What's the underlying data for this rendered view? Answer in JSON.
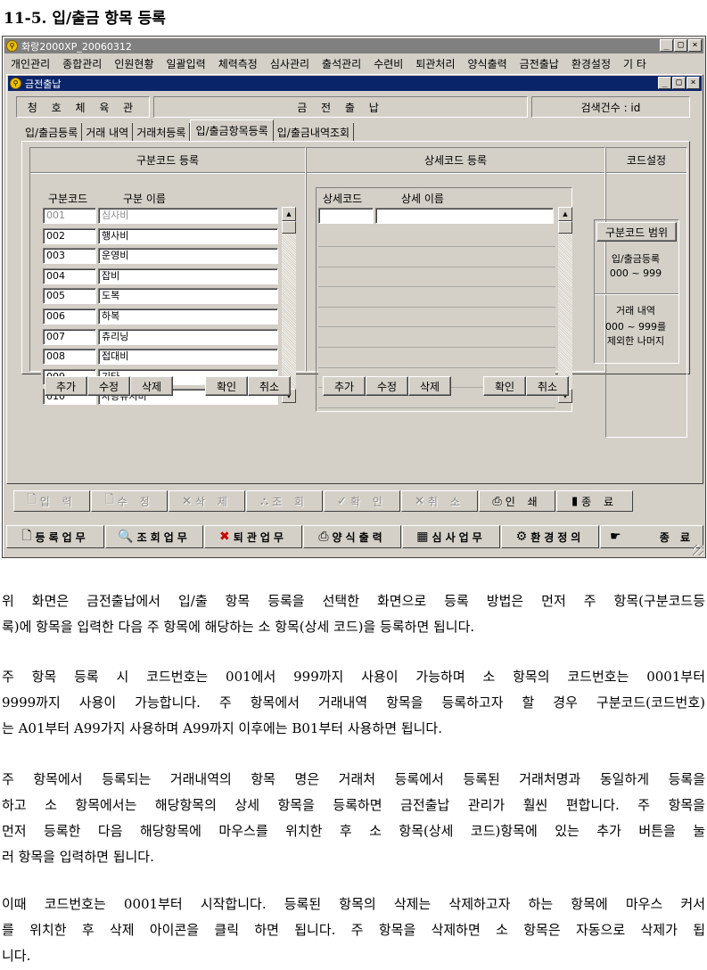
{
  "doc_heading": "11-5. 입/출금 항목 등록",
  "app": {
    "title": "화랑2000XP_20060312",
    "window_buttons": [
      "_",
      "□",
      "×"
    ],
    "menu": [
      "개인관리",
      "종합관리",
      "인원현황",
      "일괄입력",
      "체력측정",
      "심사관리",
      "출석관리",
      "수련비",
      "퇴관처리",
      "양식출력",
      "금전출납",
      "환경설정",
      "기 타"
    ]
  },
  "child": {
    "title": "금전출납",
    "header": {
      "gym_name": "청 호 체 육 관",
      "module": "금 전 출 납",
      "search_count": "검색건수 : id"
    },
    "tabs": [
      "입/출금등록",
      "거래 내역",
      "거래처등록",
      "입/출금항목등록",
      "입/출금내역조회"
    ],
    "active_tab": 3,
    "category": {
      "title": "구분코드 등록",
      "col_code": "구분코드",
      "col_name": "구분 이름",
      "rows": [
        {
          "code": "001",
          "name": "심사비"
        },
        {
          "code": "002",
          "name": "행사비"
        },
        {
          "code": "003",
          "name": "운영비"
        },
        {
          "code": "004",
          "name": "잡비"
        },
        {
          "code": "005",
          "name": "도복"
        },
        {
          "code": "006",
          "name": "하복"
        },
        {
          "code": "007",
          "name": "츄리닝"
        },
        {
          "code": "008",
          "name": "접대비"
        },
        {
          "code": "009",
          "name": "기타"
        },
        {
          "code": "010",
          "name": "차량유지비"
        }
      ],
      "buttons": [
        "추가",
        "수정",
        "삭제"
      ],
      "confirm_buttons": [
        "확인",
        "취소"
      ]
    },
    "detail": {
      "title": "상세코드 등록",
      "col_code": "상세코드",
      "col_name": "상세 이름",
      "buttons": [
        "추가",
        "수정",
        "삭제"
      ],
      "confirm_buttons": [
        "확인",
        "취소"
      ]
    },
    "code_settings": {
      "title": "코드설정",
      "range_button": "구분코드 범위",
      "item1_label": "입/출금등록",
      "item1_range": "000 ~ 999",
      "item2_label": "거래 내역",
      "item2_range": "000 ~ 999를",
      "item2_note": "제외한 나머지"
    },
    "toolbar": [
      {
        "label": "입 력",
        "icon": "new-document-icon",
        "glyph": "🗋",
        "enabled": false
      },
      {
        "label": "수 정",
        "icon": "edit-document-icon",
        "glyph": "🗋",
        "enabled": false
      },
      {
        "label": "삭 제",
        "icon": "delete-x-icon",
        "glyph": "✕",
        "enabled": false
      },
      {
        "label": "조 회",
        "icon": "binoculars-icon",
        "glyph": "⛬",
        "enabled": false
      },
      {
        "label": "확 인",
        "icon": "check-icon",
        "glyph": "✓",
        "enabled": false
      },
      {
        "label": "취 소",
        "icon": "cancel-icon",
        "glyph": "✕",
        "enabled": false
      },
      {
        "label": "인 쇄",
        "icon": "printer-icon",
        "glyph": "⎙",
        "enabled": true
      },
      {
        "label": "종 료",
        "icon": "exit-icon",
        "glyph": "▮",
        "enabled": true
      }
    ]
  },
  "main_toolbar": [
    {
      "label": "등록업무",
      "icon": "document-icon",
      "glyph": "🗋"
    },
    {
      "label": "조회업무",
      "icon": "search-icon",
      "glyph": "🔍"
    },
    {
      "label": "퇴관업무",
      "icon": "red-x-icon",
      "glyph": "✖"
    },
    {
      "label": "양식출력",
      "icon": "printer-icon",
      "glyph": "⎙"
    },
    {
      "label": "심사업무",
      "icon": "exam-icon",
      "glyph": "▦"
    },
    {
      "label": "환경정의",
      "icon": "settings-icon",
      "glyph": "⚙"
    },
    {
      "label": "종 료",
      "icon": "exit-icon",
      "glyph": "☛"
    }
  ],
  "paragraphs": [
    [
      "위 화면은 금전출납에서 입/출 항목 등록을 선택한 화면으로 등록 방법은 먼저 주 항목(구분코드등",
      "록)에 항목을 입력한 다음 주 항목에 해당하는 소 항목(상세 코드)을 등록하면 됩니다."
    ],
    [
      "주 항목 등록 시 코드번호는 001에서 999까지 사용이 가능하며 소 항목의 코드번호는 0001부터",
      "9999까지 사용이 가능합니다. 주 항목에서 거래내역 항목을 등록하고자 할 경우 구분코드(코드번호)",
      "는 A01부터 A99가지 사용하며 A99까지 이후에는 B01부터 사용하면 됩니다."
    ],
    [
      "주 항목에서 등록되는 거래내역의 항목 명은 거래처 등록에서 등록된 거래처명과 동일하게 등록을",
      "하고 소 항목에서는 해당항목의 상세 항목을 등록하면 금전출납 관리가 훨씬 편합니다. 주 항목을",
      "먼저 등록한 다음 해당항목에 마우스를 위치한 후  소 항목(상세 코드)항목에 있는 추가 버튼을 눌",
      "러 항목을 입력하면 됩니다."
    ],
    [
      "이때 코드번호는 0001부터 시작합니다. 등록된 항목의 삭제는 삭제하고자 하는 항목에 마우스 커서",
      "를 위치한 후 삭제 아이콘을 클릭 하면 됩니다. 주 항목을 삭제하면 소 항목은 자동으로 삭제가 됩",
      "니다."
    ]
  ]
}
